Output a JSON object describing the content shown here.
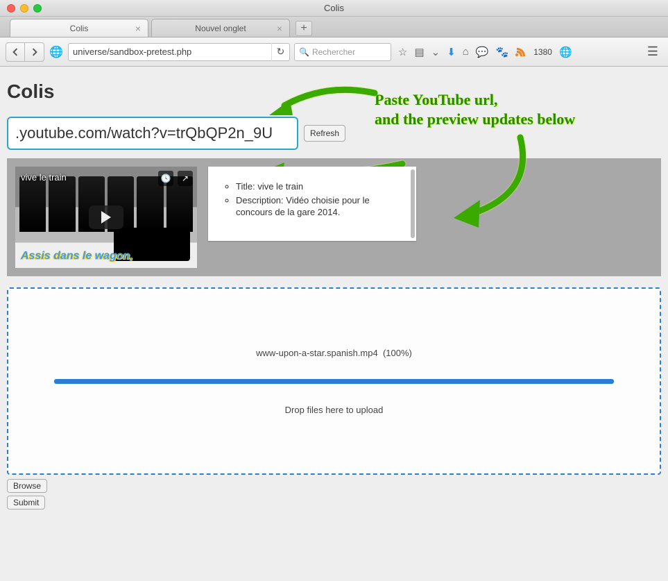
{
  "window": {
    "title": "Colis"
  },
  "tabs": [
    {
      "label": "Colis",
      "active": true
    },
    {
      "label": "Nouvel onglet",
      "active": false
    }
  ],
  "toolbar": {
    "url": "universe/sandbox-pretest.php",
    "search_placeholder": "Rechercher",
    "rss_count": "1380"
  },
  "page": {
    "heading": "Colis",
    "youtube_url": ".youtube.com/watch?v=trQbQP2n_9U",
    "refresh_label": "Refresh",
    "annotation_line1": "Paste YouTube url,",
    "annotation_line2": "and the preview updates below",
    "video": {
      "title": "vive le train",
      "caption": "Assis dans le wagon,",
      "meta_title_label": "Title:",
      "meta_title_value": "vive le train",
      "meta_desc_label": "Description:",
      "meta_desc_value": "Vidéo choisie pour le concours de la gare 2014."
    },
    "upload": {
      "filename": "www-upon-a-star.spanish.mp4",
      "percent": "(100%)",
      "drop_hint": "Drop files here to upload"
    },
    "browse_label": "Browse",
    "submit_label": "Submit"
  }
}
